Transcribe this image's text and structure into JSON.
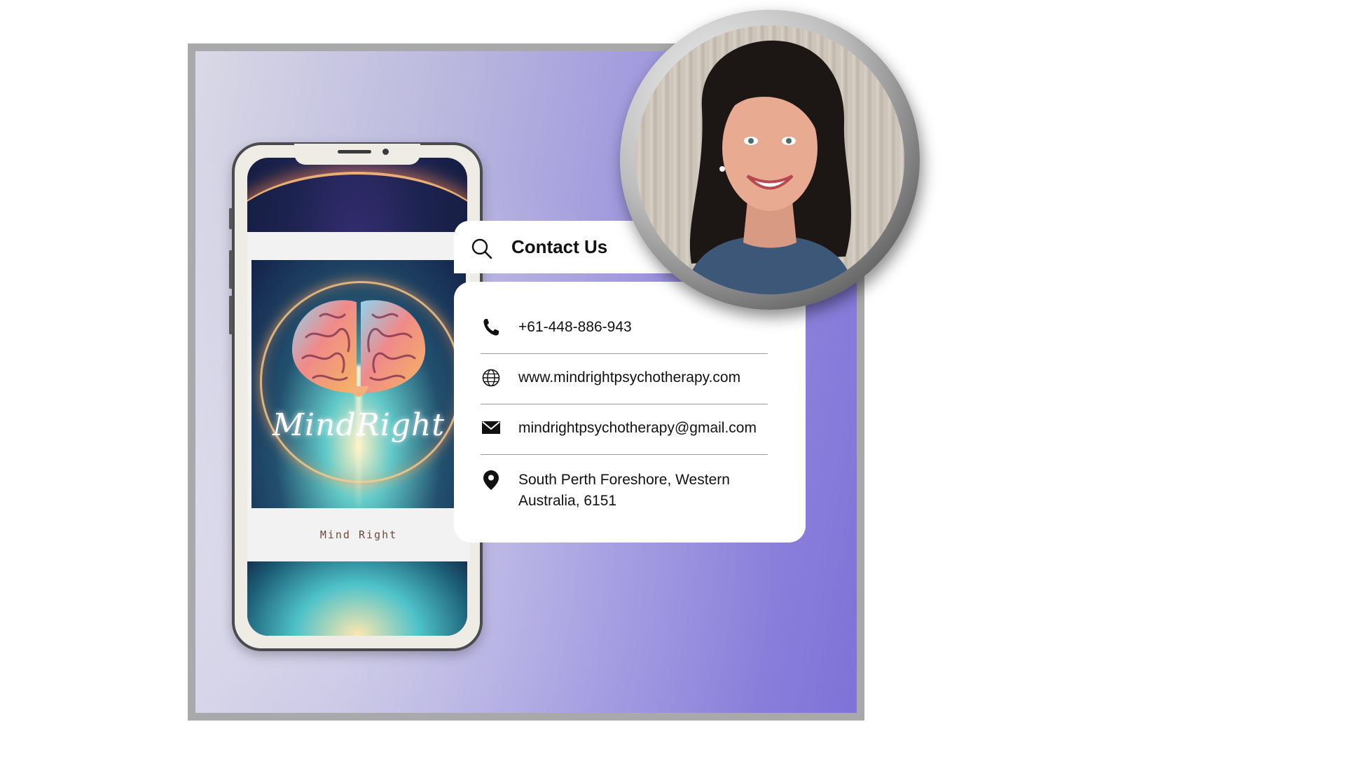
{
  "phone": {
    "inner_caption": "Mind Right",
    "logo_script": "MindRight"
  },
  "contact": {
    "title": "Contact Us",
    "phone": "+61-448-886-943",
    "website": "www.mindrightpsychotherapy.com",
    "email": "mindrightpsychotherapy@gmail.com",
    "address_line1": "South Perth Foreshore, Western",
    "address_line2": "Australia, 6151"
  },
  "icons": {
    "search": "search-icon",
    "phone": "phone-icon",
    "globe": "globe-icon",
    "mail": "mail-icon",
    "location": "location-pin-icon"
  },
  "colors": {
    "accent_purple": "#7f72d8",
    "frame_grey": "#a9a9ab",
    "text": "#111111"
  }
}
